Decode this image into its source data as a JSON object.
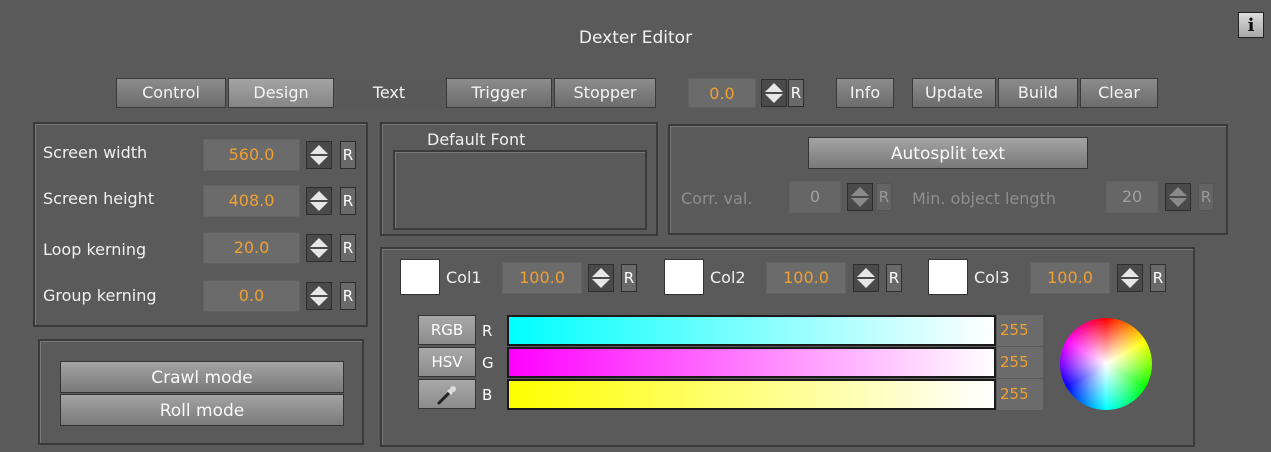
{
  "window": {
    "title": "Dexter Editor",
    "info_label": "i"
  },
  "tabs": [
    {
      "label": "Control"
    },
    {
      "label": "Design"
    },
    {
      "label": "Text"
    },
    {
      "label": "Trigger"
    },
    {
      "label": "Stopper"
    }
  ],
  "toolbar": {
    "value": "0.0",
    "reset_label": "R",
    "info_label": "Info",
    "update_label": "Update",
    "build_label": "Build",
    "clear_label": "Clear"
  },
  "screen": {
    "width_label": "Screen width",
    "width_value": "560.0",
    "height_label": "Screen height",
    "height_value": "408.0",
    "loop_label": "Loop kerning",
    "loop_value": "20.0",
    "group_label": "Group kerning",
    "group_value": "0.0",
    "reset_label": "R"
  },
  "font": {
    "title": "Default Font"
  },
  "autosplit": {
    "button_label": "Autosplit text",
    "corr_label": "Corr. val.",
    "corr_value": "0",
    "min_label": "Min. object length",
    "min_value": "20",
    "reset_label": "R"
  },
  "modes": {
    "crawl_label": "Crawl mode",
    "roll_label": "Roll mode"
  },
  "colors": {
    "col1_label": "Col1",
    "col1_value": "100.0",
    "col2_label": "Col2",
    "col2_value": "100.0",
    "col3_label": "Col3",
    "col3_value": "100.0",
    "reset_label": "R",
    "rgb_label": "RGB",
    "hsv_label": "HSV",
    "r_label": "R",
    "g_label": "G",
    "b_label": "B",
    "r_value": "255",
    "g_value": "255",
    "b_value": "255",
    "r_color": "#00ffff",
    "g_color": "#ff00ff",
    "b_color": "#ffff00"
  }
}
